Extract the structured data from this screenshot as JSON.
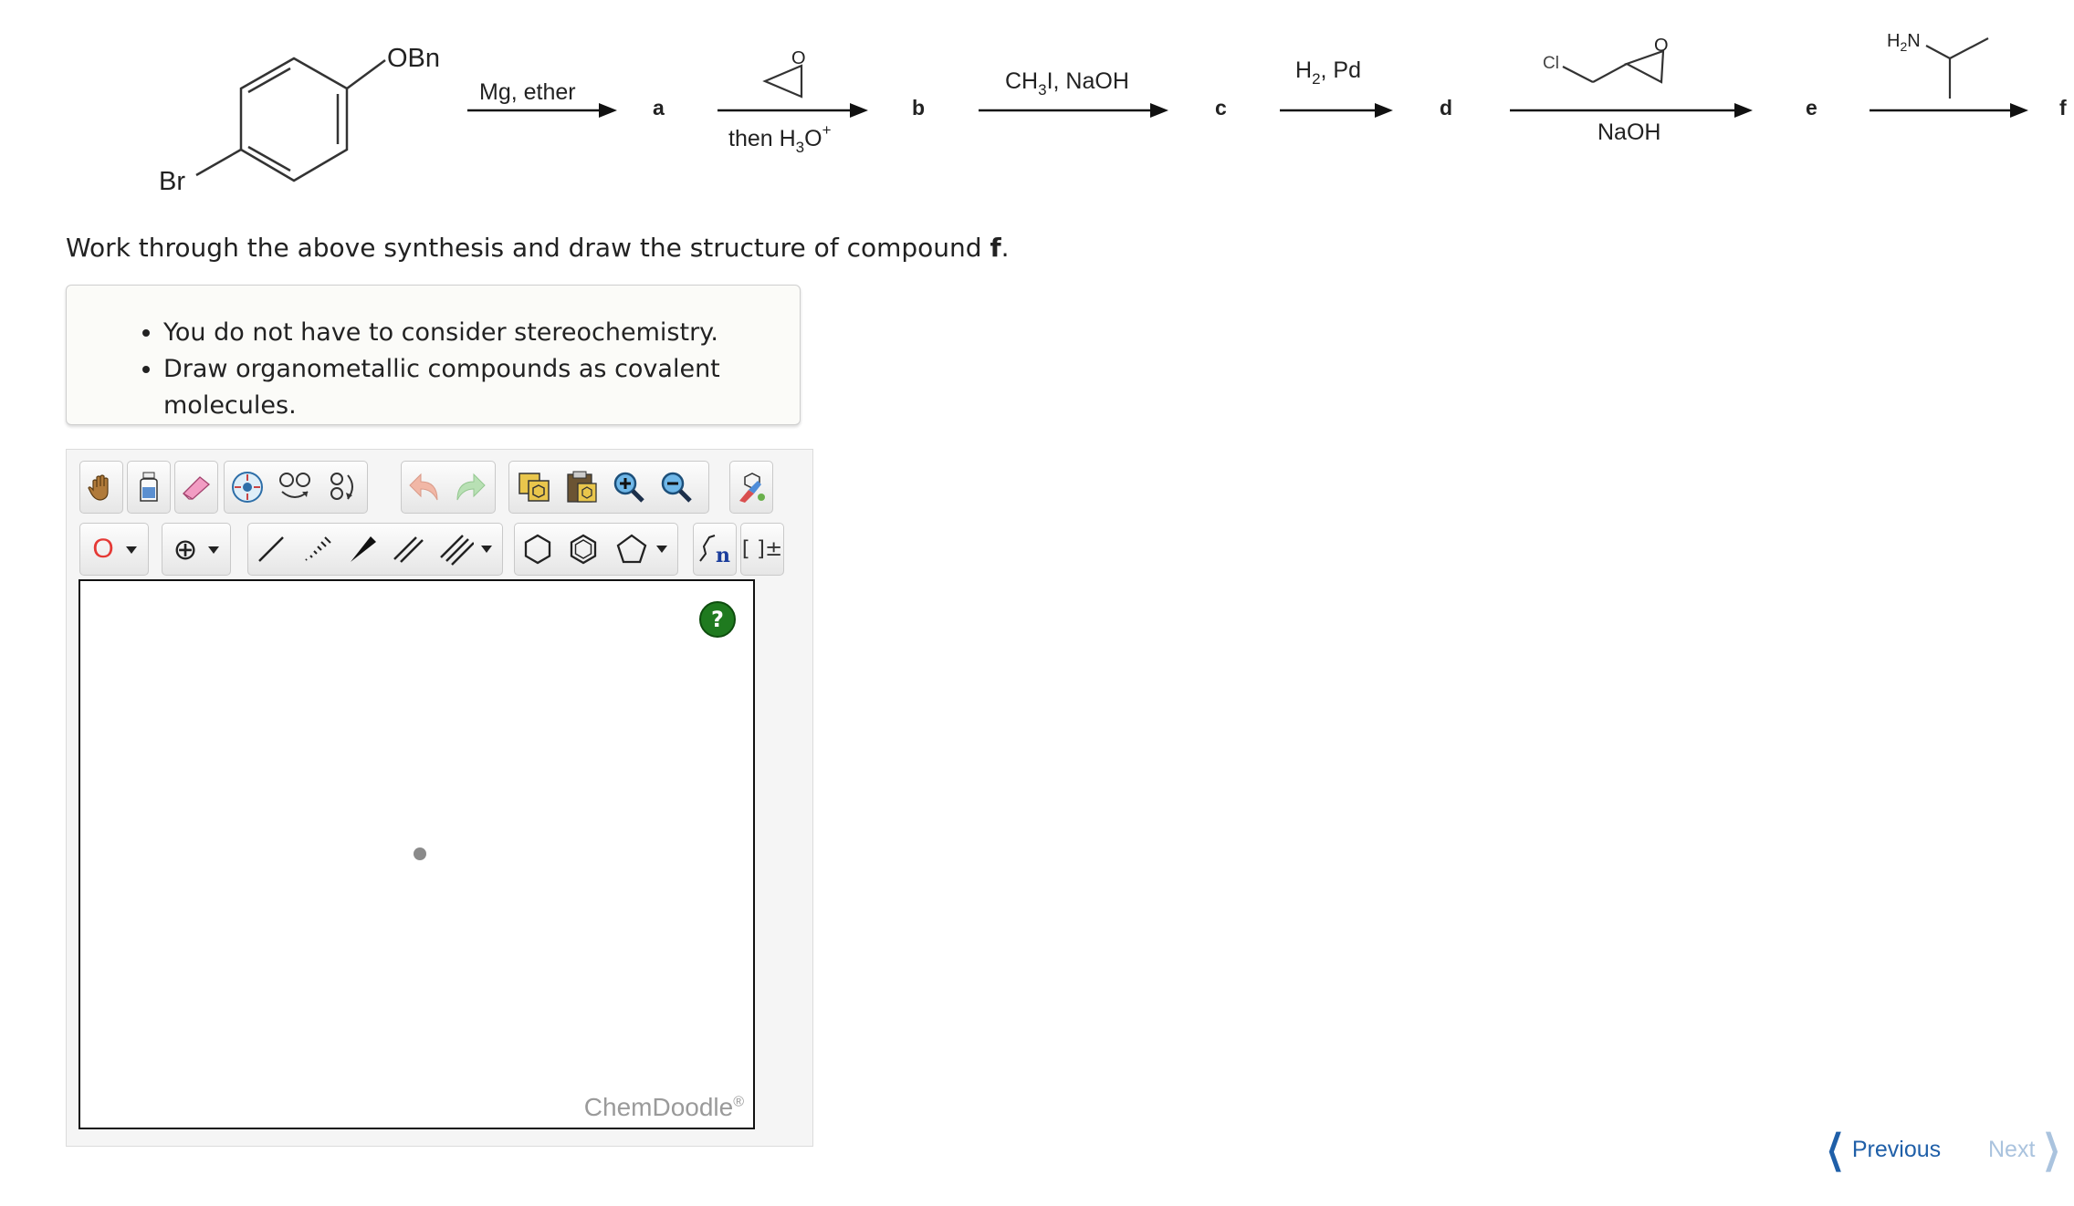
{
  "scheme": {
    "start_substituent_top": "OBn",
    "start_substituent_bottom": "Br",
    "steps": [
      {
        "above": "Mg, ether",
        "below": "",
        "product": "a"
      },
      {
        "above": "",
        "below_prefix": "then H",
        "below_sub": "3",
        "below_mid": "O",
        "below_sup": "+",
        "reagent_structure": "epoxide",
        "product": "b"
      },
      {
        "above_prefix": "CH",
        "above_sub": "3",
        "above_suffix": "I, NaOH",
        "product": "c"
      },
      {
        "above_prefix": "H",
        "above_sub": "2",
        "above_suffix": ", Pd",
        "product": "d"
      },
      {
        "below": "NaOH",
        "reagent_structure": "epichlorohydrin",
        "reagent_label_cl": "Cl",
        "reagent_label_o": "O",
        "product": "e"
      },
      {
        "reagent_structure": "isopropylamine",
        "reagent_label_prefix": "H",
        "reagent_label_sub": "2",
        "reagent_label_suffix": "N",
        "product": "f"
      }
    ],
    "epoxide_o": "O"
  },
  "question": {
    "text": "Work through the above synthesis and draw the structure of compound ",
    "target": "f",
    "end": "."
  },
  "hints": [
    "You do not have to consider stereochemistry.",
    "Draw organometallic compounds as covalent molecules."
  ],
  "toolbar": {
    "row1": [
      "hand-tool",
      "clear-tool",
      "eraser-tool",
      "center-tool",
      "flip-tool",
      "rotate-tool",
      "undo",
      "redo",
      "templates",
      "paste",
      "zoom-in",
      "zoom-out",
      "clean-tool"
    ],
    "element_label": "O",
    "charge_label": "⊕",
    "bracket_label": "[ ]±",
    "sgroup_label": "n"
  },
  "canvas": {
    "help_label": "?",
    "watermark": "ChemDoodle",
    "watermark_reg": "®"
  },
  "nav": {
    "previous": "Previous",
    "next": "Next"
  },
  "colors": {
    "prev_link": "#1f5fa8",
    "next_link_disabled": "#aac3de",
    "help_button": "#1f7a1f",
    "element_label": "#e53935"
  }
}
